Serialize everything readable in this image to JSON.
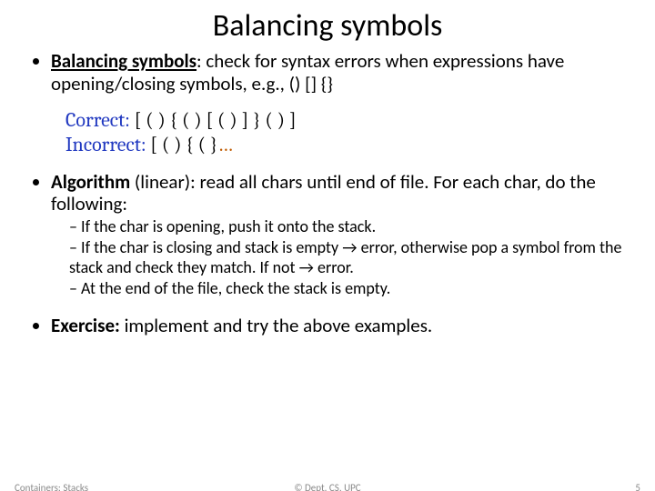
{
  "title": "Balancing symbols",
  "bullets": {
    "b1_bold": "Balancing symbols",
    "b1_rest": ": check for syntax errors when expressions have opening/closing symbols, e.g., () [] {}",
    "example_correct_label": "Correct: ",
    "example_correct_seq": "[ ( ) { ( ) [ ( ) ] } ( ) ]",
    "example_incorrect_label": "Incorrect:  ",
    "example_incorrect_seq": "[ ( ) { ( }",
    "example_incorrect_tail": "…",
    "b2_bold": "Algorithm",
    "b2_rest": " (linear): read all chars until end of file. For each char, do the following:",
    "s1": "If the char is opening, push it onto the stack.",
    "s2a": "If the char is closing and stack is empty ",
    "s2arrow": "→",
    "s2b": " error, otherwise pop a symbol from the stack and check they match. If not ",
    "s2arrow2": "→",
    "s2c": " error.",
    "s3": "At the end of the file, check the stack is empty.",
    "b3_bold": "Exercise:",
    "b3_rest": " implement and try the above examples."
  },
  "footer": {
    "left": "Containers: Stacks",
    "center": "© Dept. CS, UPC",
    "right": "5"
  }
}
